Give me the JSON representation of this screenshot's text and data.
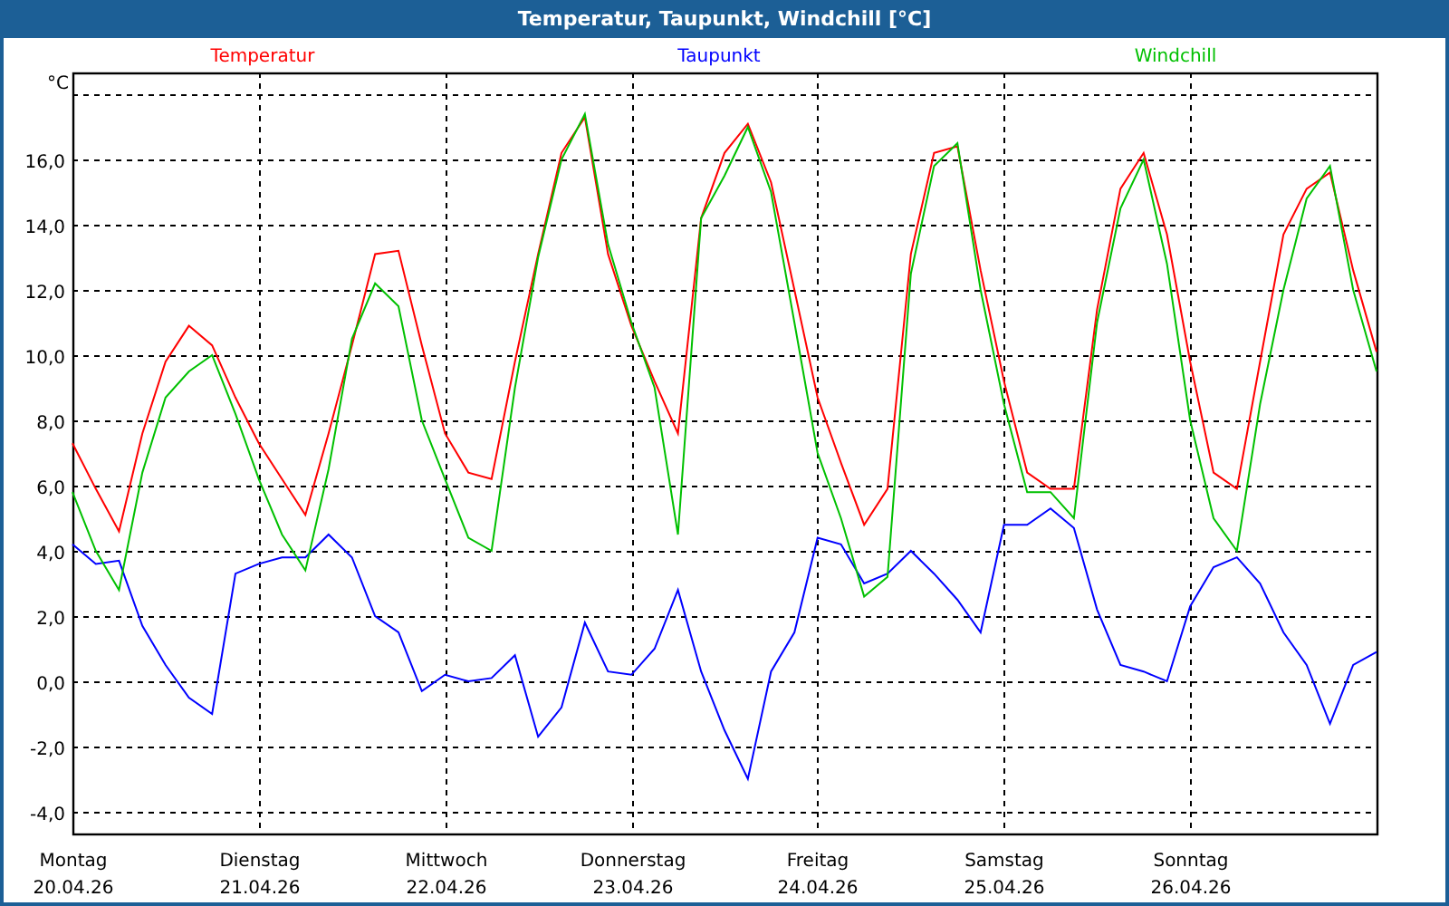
{
  "window": {
    "title": "Temperatur, Taupunkt, Windchill [°C]"
  },
  "chart": {
    "dates": [
      "20.04.26",
      "21.04.26",
      "22.04.26",
      "23.04.26",
      "24.04.26",
      "25.04.26",
      "26.04.26"
    ],
    "chart_data": {
      "type": "line",
      "ylabel": "°C",
      "categories": [
        "Montag",
        null,
        null,
        null,
        null,
        null,
        null,
        null,
        "Dienstag",
        null,
        null,
        null,
        null,
        null,
        null,
        null,
        "Mittwoch",
        null,
        null,
        null,
        null,
        null,
        null,
        null,
        "Donnerstag",
        null,
        null,
        null,
        null,
        null,
        null,
        null,
        "Freitag",
        null,
        null,
        null,
        null,
        null,
        null,
        null,
        "Samstag",
        null,
        null,
        null,
        null,
        null,
        null,
        null,
        "Sonntag",
        null,
        null,
        null,
        null,
        null,
        null,
        null,
        null
      ],
      "series": [
        {
          "name": "Temperatur",
          "color": "#ff0000",
          "values": [
            7.3,
            5.9,
            4.6,
            7.6,
            9.8,
            10.9,
            10.3,
            8.7,
            7.3,
            6.2,
            5.1,
            7.6,
            10.3,
            13.1,
            13.2,
            10.3,
            7.6,
            6.4,
            6.2,
            9.8,
            13.1,
            16.2,
            17.3,
            13.1,
            10.9,
            9.2,
            7.6,
            14.2,
            16.2,
            17.1,
            15.3,
            12.0,
            8.7,
            6.7,
            4.8,
            5.9,
            13.1,
            16.2,
            16.4,
            12.6,
            9.2,
            6.4,
            5.9,
            5.9,
            11.4,
            15.1,
            16.2,
            13.7,
            9.8,
            6.4,
            5.9,
            9.8,
            13.7,
            15.1,
            15.6,
            12.6,
            10.1
          ]
        },
        {
          "name": "Taupunkt",
          "color": "#0000ff",
          "values": [
            4.2,
            3.6,
            3.7,
            1.7,
            0.5,
            -0.5,
            -1.0,
            3.3,
            3.6,
            3.8,
            3.8,
            4.5,
            3.8,
            2.0,
            1.5,
            -0.3,
            0.2,
            0.0,
            0.1,
            0.8,
            -1.7,
            -0.8,
            1.8,
            0.3,
            0.2,
            1.0,
            2.8,
            0.3,
            -1.5,
            -3.0,
            0.3,
            1.5,
            4.4,
            4.2,
            3.0,
            3.3,
            4.0,
            3.3,
            2.5,
            1.5,
            4.8,
            4.8,
            5.3,
            4.7,
            2.2,
            0.5,
            0.3,
            0.0,
            2.3,
            3.5,
            3.8,
            3.0,
            1.5,
            0.5,
            -1.3,
            0.5,
            0.9
          ]
        },
        {
          "name": "Windchill",
          "color": "#00c000",
          "values": [
            5.8,
            4,
            2.8,
            6.4,
            8.7,
            9.5,
            10,
            8.2,
            6.2,
            4.5,
            3.4,
            6.5,
            10.5,
            12.2,
            11.5,
            8,
            6.2,
            4.4,
            4.0,
            9,
            13,
            16,
            17.4,
            13.4,
            11,
            9,
            4.5,
            14.2,
            15.5,
            17,
            15,
            11,
            7,
            5,
            2.6,
            3.2,
            12.5,
            15.8,
            16.5,
            12,
            8.5,
            5.8,
            5.8,
            5,
            11,
            14.5,
            16,
            12.8,
            8,
            5,
            4,
            8.5,
            12,
            14.8,
            15.8,
            12,
            9.5
          ]
        }
      ],
      "grid": true,
      "ylim": [
        -4.67,
        18.67
      ],
      "yticks": [
        {
          "value": -4,
          "label": "-4,0"
        },
        {
          "value": -2,
          "label": "-2,0"
        },
        {
          "value": 0,
          "label": "0,0"
        },
        {
          "value": 2,
          "label": "2,0"
        },
        {
          "value": 4,
          "label": "4,0"
        },
        {
          "value": 6,
          "label": "6,0"
        },
        {
          "value": 8,
          "label": "8,0"
        },
        {
          "value": 10,
          "label": "10,0"
        },
        {
          "value": 12,
          "label": "12,0"
        },
        {
          "value": 14,
          "label": "14,0"
        },
        {
          "value": 16,
          "label": "16,0"
        }
      ]
    }
  }
}
